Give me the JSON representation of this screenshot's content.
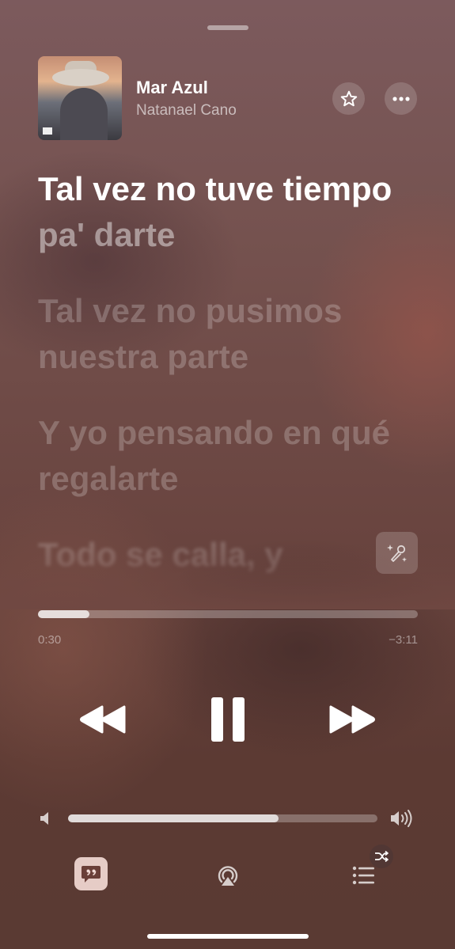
{
  "track": {
    "title": "Mar Azul",
    "artist": "Natanael Cano"
  },
  "lyrics": {
    "current_sung": "Tal vez no tuve tiempo",
    "current_pending": "pa' darte",
    "upcoming": [
      "Tal vez no pusimos nuestra parte",
      "Y yo pensando en qué regalarte",
      "Todo se calla, y"
    ]
  },
  "playback": {
    "elapsed": "0:30",
    "remaining": "−3:11",
    "progress_fraction": 0.136,
    "volume_fraction": 0.68,
    "state": "playing"
  },
  "icons": {
    "favorite": "star-icon",
    "more": "ellipsis-icon",
    "karaoke": "microphone-sparkle-icon",
    "rewind": "backward-icon",
    "pause": "pause-icon",
    "forward": "forward-icon",
    "lyrics": "quote-bubble-icon",
    "airplay": "airplay-icon",
    "queue": "list-icon",
    "shuffle": "shuffle-icon"
  },
  "colors": {
    "lyrics_button_bg": "#f3dcd6",
    "text_primary": "#ffffff"
  }
}
